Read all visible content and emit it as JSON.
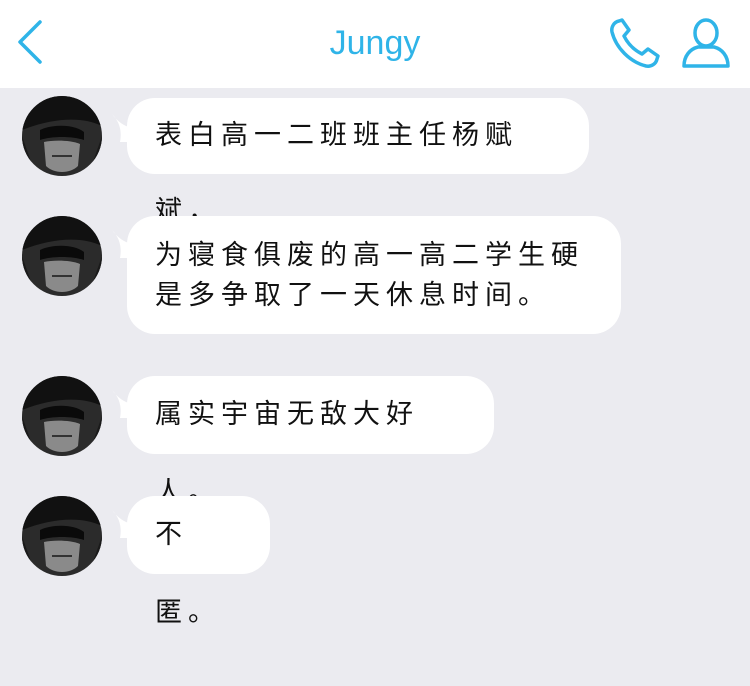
{
  "header": {
    "title": "Jungy",
    "back_icon": "chevron-left-icon",
    "call_icon": "phone-icon",
    "profile_icon": "person-icon",
    "accent_color": "#2fb4e8"
  },
  "messages": [
    {
      "text": "表白高一二班班主任杨赋斌，"
    },
    {
      "text": "为寝食俱废的高一高二学生硬是多争取了一天休息时间。"
    },
    {
      "text": "属实宇宙无敌大好人。"
    },
    {
      "text": "不匿。"
    }
  ]
}
